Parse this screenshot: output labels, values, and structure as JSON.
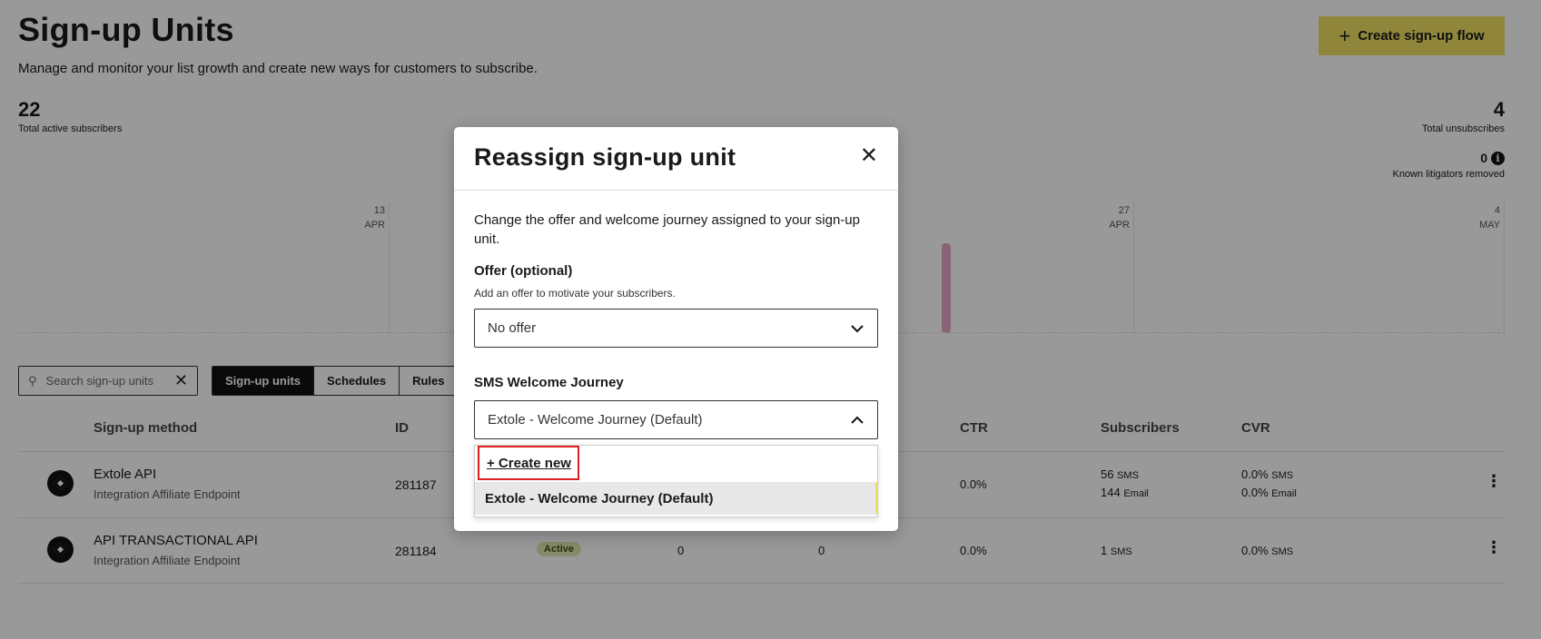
{
  "header": {
    "title": "Sign-up Units",
    "subtitle": "Manage and monitor your list growth and create new ways for customers to subscribe.",
    "create_button": "Create sign-up flow"
  },
  "stats": {
    "active": {
      "value": "22",
      "label": "Total active subscribers"
    },
    "unsubscribes": {
      "value": "4",
      "label": "Total unsubscribes"
    },
    "litigators": {
      "value": "0",
      "label": "Known litigators removed"
    }
  },
  "chart": {
    "dates": [
      {
        "day": "13",
        "month": "APR"
      },
      {
        "day": "27",
        "month": "APR"
      },
      {
        "day": "4",
        "month": "MAY"
      }
    ],
    "accent_color": "#e8a6c7"
  },
  "toolbar": {
    "search_placeholder": "Search sign-up units",
    "tabs": [
      "Sign-up units",
      "Schedules",
      "Rules"
    ]
  },
  "table": {
    "headers": {
      "method": "Sign-up method",
      "id": "ID",
      "ctr": "CTR",
      "subscribers": "Subscribers",
      "cvr": "CVR"
    },
    "rows": [
      {
        "name": "Extole API",
        "sub": "Integration Affiliate Endpoint",
        "id": "281187",
        "ctr": "0.0%",
        "subs_sms": "56",
        "subs_sms_unit": "SMS",
        "subs_email": "144",
        "subs_email_unit": "Email",
        "cvr_sms": "0.0%",
        "cvr_sms_unit": "SMS",
        "cvr_email": "0.0%",
        "cvr_email_unit": "Email"
      },
      {
        "name": "API TRANSACTIONAL API",
        "sub": "Integration Affiliate Endpoint",
        "id": "281184",
        "status": "Active",
        "col_a": "0",
        "col_b": "0",
        "ctr": "0.0%",
        "subs_sms": "1",
        "subs_sms_unit": "SMS",
        "cvr_sms": "0.0%",
        "cvr_sms_unit": "SMS"
      }
    ]
  },
  "modal": {
    "title": "Reassign sign-up unit",
    "description": "Change the offer and welcome journey assigned to your sign-up unit.",
    "offer_label": "Offer",
    "offer_optional": "(optional)",
    "offer_help": "Add an offer to motivate your subscribers.",
    "offer_value": "No offer",
    "journey_label": "SMS Welcome Journey",
    "journey_value": "Extole - Welcome Journey (Default)",
    "dropdown": {
      "create_new": "+ Create new",
      "options": [
        "Extole - Welcome Journey (Default)"
      ]
    }
  },
  "colors": {
    "accent_yellow": "#f0df63",
    "highlight_red": "#e02020"
  }
}
